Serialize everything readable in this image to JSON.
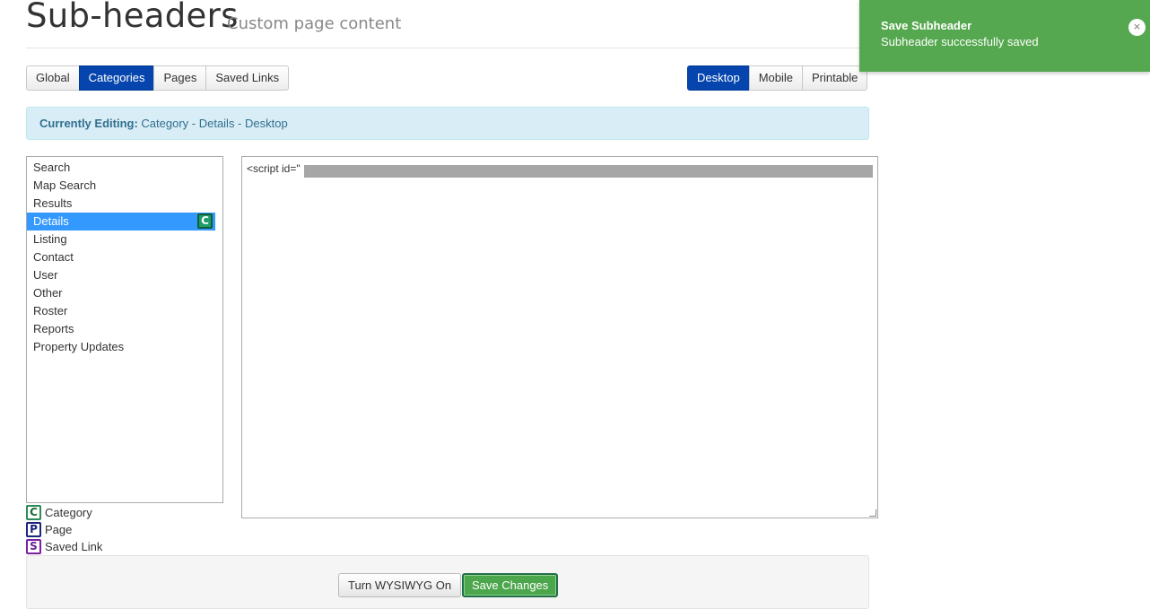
{
  "header": {
    "title": "Sub-headers",
    "subtitle": "Custom page content"
  },
  "scope_tabs": [
    {
      "label": "Global",
      "active": false
    },
    {
      "label": "Categories",
      "active": true
    },
    {
      "label": "Pages",
      "active": false
    },
    {
      "label": "Saved Links",
      "active": false
    }
  ],
  "device_tabs": [
    {
      "label": "Desktop",
      "active": true
    },
    {
      "label": "Mobile",
      "active": false
    },
    {
      "label": "Printable",
      "active": false
    }
  ],
  "editing": {
    "prefix": "Currently Editing:",
    "value": "Category - Details - Desktop"
  },
  "categories": [
    {
      "label": "Search",
      "selected": false,
      "badge": ""
    },
    {
      "label": "Map Search",
      "selected": false,
      "badge": ""
    },
    {
      "label": "Results",
      "selected": false,
      "badge": ""
    },
    {
      "label": "Details",
      "selected": true,
      "badge": "C"
    },
    {
      "label": "Listing",
      "selected": false,
      "badge": ""
    },
    {
      "label": "Contact",
      "selected": false,
      "badge": ""
    },
    {
      "label": "User",
      "selected": false,
      "badge": ""
    },
    {
      "label": "Other",
      "selected": false,
      "badge": ""
    },
    {
      "label": "Roster",
      "selected": false,
      "badge": ""
    },
    {
      "label": "Reports",
      "selected": false,
      "badge": ""
    },
    {
      "label": "Property Updates",
      "selected": false,
      "badge": ""
    }
  ],
  "legend": [
    {
      "letter": "C",
      "label": "Category"
    },
    {
      "letter": "P",
      "label": "Page"
    },
    {
      "letter": "S",
      "label": "Saved Link"
    }
  ],
  "editor": {
    "content": "<script id=\""
  },
  "footer": {
    "wysiwyg_label": "Turn WYSIWYG On",
    "save_label": "Save Changes"
  },
  "toast": {
    "title": "Save Subheader",
    "message": "Subheader successfully saved",
    "close": "×"
  },
  "colors": {
    "primary": "#0645ad",
    "selected_row": "#3399ff",
    "toast_bg": "#55a84f",
    "save_bg": "#4ca64c",
    "banner_bg": "#d9edf7"
  }
}
